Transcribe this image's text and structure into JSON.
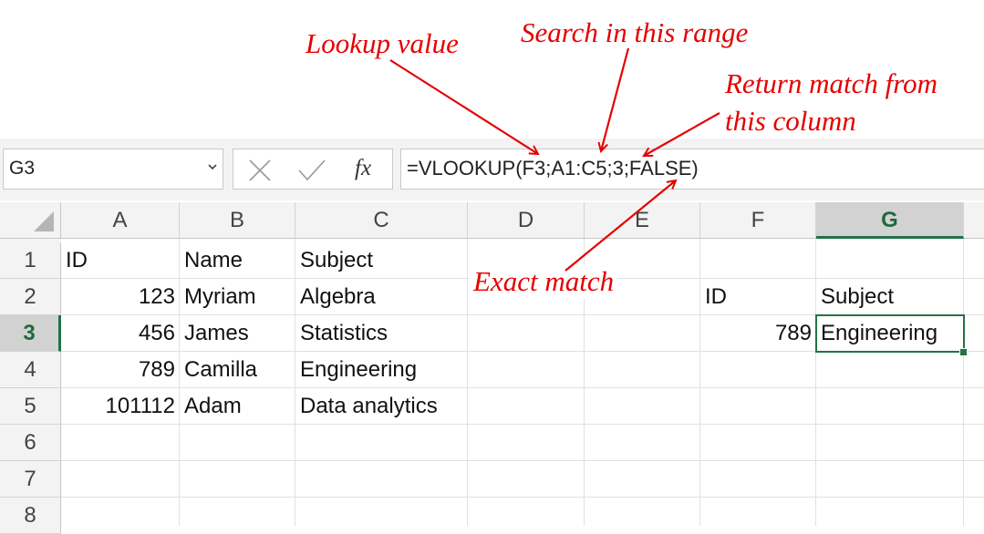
{
  "annotations": {
    "lookup_value": "Lookup value",
    "search_range": "Search in this range",
    "return_col_line1": "Return match from",
    "return_col_line2": "this column",
    "exact_match": "Exact match"
  },
  "formula_bar": {
    "name_box": "G3",
    "cancel_icon": "close-icon",
    "enter_icon": "check-icon",
    "fx_label": "fx",
    "formula": "=VLOOKUP(F3;A1:C5;3;FALSE)"
  },
  "columns": [
    "A",
    "B",
    "C",
    "D",
    "E",
    "F",
    "G"
  ],
  "rows": [
    "1",
    "2",
    "3",
    "4",
    "5",
    "6",
    "7",
    "8"
  ],
  "selected_cell": "G3",
  "cells": {
    "A1": "ID",
    "B1": "Name",
    "C1": "Subject",
    "A2": "123",
    "B2": "Myriam",
    "C2": "Algebra",
    "A3": "456",
    "B3": "James",
    "C3": "Statistics",
    "A4": "789",
    "B4": "Camilla",
    "C4": "Engineering",
    "A5": "101112",
    "B5": "Adam",
    "C5": "Data analytics",
    "F2": "ID",
    "G2": "Subject",
    "F3": "789",
    "G3": "Engineering"
  },
  "colors": {
    "annotation": "#e60000",
    "excel_green": "#217346"
  }
}
